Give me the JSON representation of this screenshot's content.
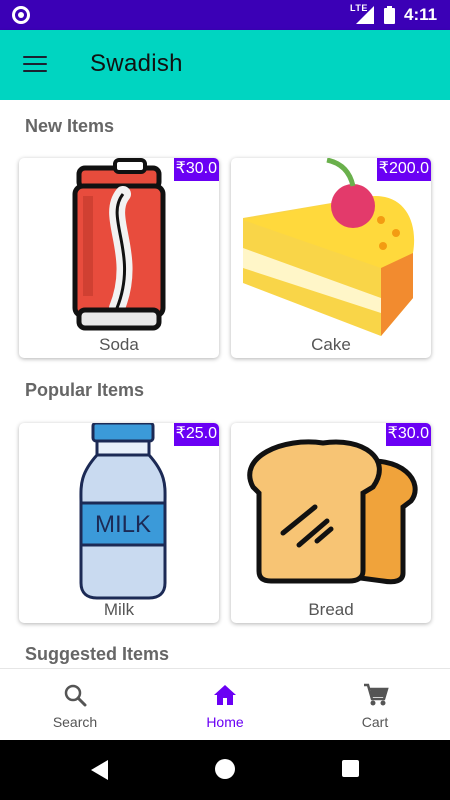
{
  "status_bar": {
    "network": "LTE",
    "time": "4:11"
  },
  "app_bar": {
    "title": "Swadish"
  },
  "sections": [
    {
      "title": "New Items",
      "items": [
        {
          "name": "Soda",
          "price": "₹30.0",
          "icon": "soda-can-icon"
        },
        {
          "name": "Cake",
          "price": "₹200.0",
          "icon": "cake-slice-icon"
        }
      ]
    },
    {
      "title": "Popular Items",
      "items": [
        {
          "name": "Milk",
          "price": "₹25.0",
          "icon": "milk-bottle-icon",
          "label": "MILK"
        },
        {
          "name": "Bread",
          "price": "₹30.0",
          "icon": "bread-slice-icon"
        }
      ]
    },
    {
      "title": "Suggested Items"
    }
  ],
  "bottom_nav": [
    {
      "label": "Search",
      "icon": "search-icon"
    },
    {
      "label": "Home",
      "icon": "home-icon",
      "active": true
    },
    {
      "label": "Cart",
      "icon": "cart-icon"
    }
  ],
  "colors": {
    "status_bar": "#3b00b6",
    "app_bar": "#00d5c1",
    "accent": "#6a00f4"
  }
}
